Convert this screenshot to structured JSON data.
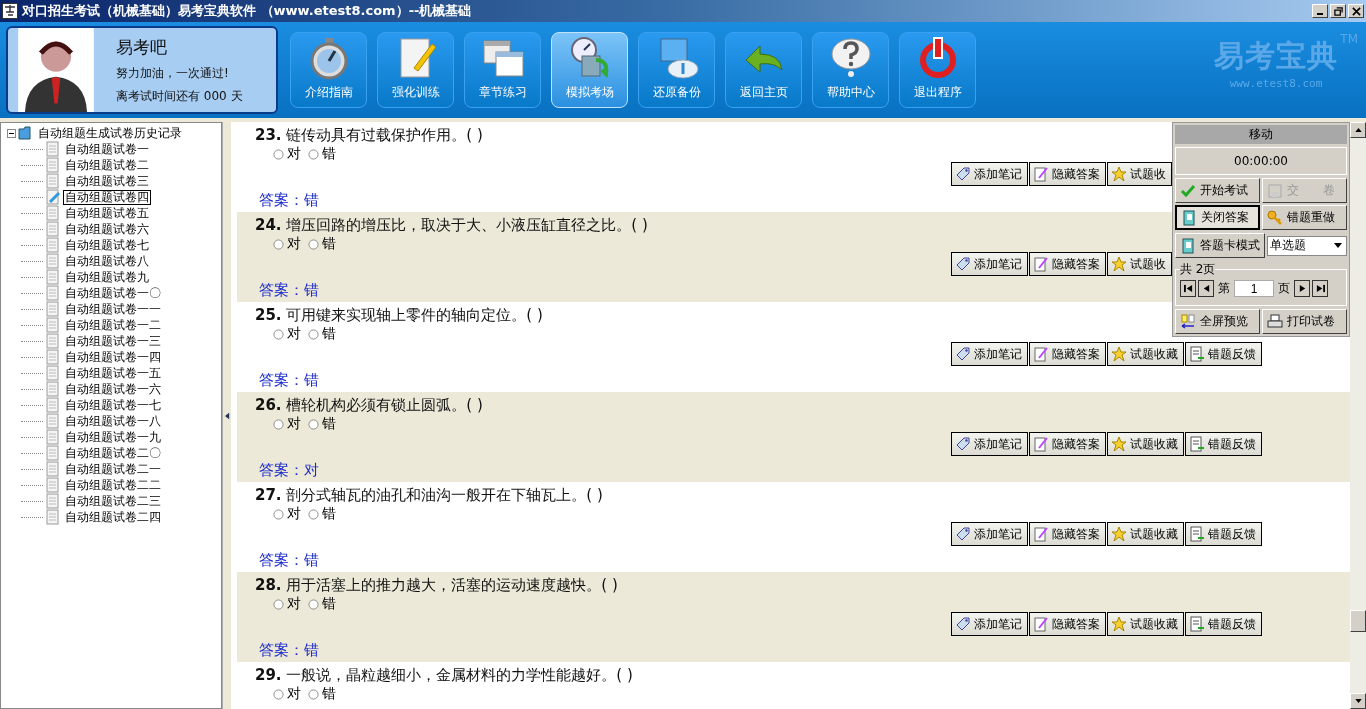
{
  "window": {
    "title": "对口招生考试（机械基础）易考宝典软件 （www.etest8.com）--机械基础"
  },
  "profile": {
    "name": "易考吧",
    "motto": "努力加油，一次通过!",
    "countdown": "离考试时间还有 000 天"
  },
  "toolbar": [
    {
      "kind": "stopwatch",
      "label": "介绍指南",
      "selected": false
    },
    {
      "kind": "notepad",
      "label": "强化训练",
      "selected": false
    },
    {
      "kind": "windows",
      "label": "章节练习",
      "selected": false
    },
    {
      "kind": "clock",
      "label": "模拟考场",
      "selected": true
    },
    {
      "kind": "backup",
      "label": "还原备份",
      "selected": false
    },
    {
      "kind": "back",
      "label": "返回主页",
      "selected": false
    },
    {
      "kind": "help",
      "label": "帮助中心",
      "selected": false
    },
    {
      "kind": "power",
      "label": "退出程序",
      "selected": false
    }
  ],
  "logo": {
    "name": "易考宝典",
    "trademark": "TM",
    "url": "www.etest8.com"
  },
  "tree": {
    "label": "自动组题生成试卷历史记录",
    "expanded": true,
    "children": [
      {
        "label": "自动组题试卷一",
        "selected": false
      },
      {
        "label": "自动组题试卷二",
        "selected": false
      },
      {
        "label": "自动组题试卷三",
        "selected": false
      },
      {
        "label": "自动组题试卷四",
        "selected": true
      },
      {
        "label": "自动组题试卷五",
        "selected": false
      },
      {
        "label": "自动组题试卷六",
        "selected": false
      },
      {
        "label": "自动组题试卷七",
        "selected": false
      },
      {
        "label": "自动组题试卷八",
        "selected": false
      },
      {
        "label": "自动组题试卷九",
        "selected": false
      },
      {
        "label": "自动组题试卷一〇",
        "selected": false
      },
      {
        "label": "自动组题试卷一一",
        "selected": false
      },
      {
        "label": "自动组题试卷一二",
        "selected": false
      },
      {
        "label": "自动组题试卷一三",
        "selected": false
      },
      {
        "label": "自动组题试卷一四",
        "selected": false
      },
      {
        "label": "自动组题试卷一五",
        "selected": false
      },
      {
        "label": "自动组题试卷一六",
        "selected": false
      },
      {
        "label": "自动组题试卷一七",
        "selected": false
      },
      {
        "label": "自动组题试卷一八",
        "selected": false
      },
      {
        "label": "自动组题试卷一九",
        "selected": false
      },
      {
        "label": "自动组题试卷二〇",
        "selected": false
      },
      {
        "label": "自动组题试卷二一",
        "selected": false
      },
      {
        "label": "自动组题试卷二二",
        "selected": false
      },
      {
        "label": "自动组题试卷二三",
        "selected": false
      },
      {
        "label": "自动组题试卷二四",
        "selected": false
      }
    ]
  },
  "questions": [
    {
      "number": "23.",
      "text": "链传动具有过载保护作用。( )",
      "options": [
        {
          "label": "对",
          "selected": false
        },
        {
          "label": "错",
          "selected": false
        }
      ],
      "actions": [
        {
          "kind": "note",
          "label": "添加笔记"
        },
        {
          "kind": "hide",
          "label": "隐藏答案"
        },
        {
          "kind": "star",
          "label": "试题收"
        }
      ],
      "answer": "答案：错"
    },
    {
      "number": "24.",
      "text": "增压回路的增压比，取决于大、小液压缸直径之比。( )",
      "options": [
        {
          "label": "对",
          "selected": false
        },
        {
          "label": "错",
          "selected": false
        }
      ],
      "actions": [
        {
          "kind": "note",
          "label": "添加笔记"
        },
        {
          "kind": "hide",
          "label": "隐藏答案"
        },
        {
          "kind": "star",
          "label": "试题收"
        }
      ],
      "answer": "答案：错"
    },
    {
      "number": "25.",
      "text": "可用键来实现轴上零件的轴向定位。( )",
      "options": [
        {
          "label": "对",
          "selected": false
        },
        {
          "label": "错",
          "selected": false
        }
      ],
      "actions": [
        {
          "kind": "note",
          "label": "添加笔记"
        },
        {
          "kind": "hide",
          "label": "隐藏答案"
        },
        {
          "kind": "star",
          "label": "试题收藏"
        },
        {
          "kind": "feedback",
          "label": "错题反馈"
        }
      ],
      "answer": "答案：错"
    },
    {
      "number": "26.",
      "text": "槽轮机构必须有锁止圆弧。( )",
      "options": [
        {
          "label": "对",
          "selected": false
        },
        {
          "label": "错",
          "selected": false
        }
      ],
      "actions": [
        {
          "kind": "note",
          "label": "添加笔记"
        },
        {
          "kind": "hide",
          "label": "隐藏答案"
        },
        {
          "kind": "star",
          "label": "试题收藏"
        },
        {
          "kind": "feedback",
          "label": "错题反馈"
        }
      ],
      "answer": "答案：对"
    },
    {
      "number": "27.",
      "text": "剖分式轴瓦的油孔和油沟一般开在下轴瓦上。( )",
      "options": [
        {
          "label": "对",
          "selected": false
        },
        {
          "label": "错",
          "selected": false
        }
      ],
      "actions": [
        {
          "kind": "note",
          "label": "添加笔记"
        },
        {
          "kind": "hide",
          "label": "隐藏答案"
        },
        {
          "kind": "star",
          "label": "试题收藏"
        },
        {
          "kind": "feedback",
          "label": "错题反馈"
        }
      ],
      "answer": "答案：错"
    },
    {
      "number": "28.",
      "text": "用于活塞上的推力越大，活塞的运动速度越快。( )",
      "options": [
        {
          "label": "对",
          "selected": false
        },
        {
          "label": "错",
          "selected": false
        }
      ],
      "actions": [
        {
          "kind": "note",
          "label": "添加笔记"
        },
        {
          "kind": "hide",
          "label": "隐藏答案"
        },
        {
          "kind": "star",
          "label": "试题收藏"
        },
        {
          "kind": "feedback",
          "label": "错题反馈"
        }
      ],
      "answer": "答案：错"
    },
    {
      "number": "29.",
      "text": "一般说，晶粒越细小，金属材料的力学性能越好。( )",
      "options": [
        {
          "label": "对",
          "selected": false
        },
        {
          "label": "错",
          "selected": false
        }
      ]
    }
  ],
  "panel": {
    "title": "移动",
    "timer": "00:00:00",
    "buttons": [
      {
        "kind": "check",
        "label": "开始考试",
        "disabled": false,
        "selected": false
      },
      {
        "kind": "save",
        "label": "交　　卷",
        "disabled": true,
        "selected": false
      },
      {
        "kind": "book",
        "label": "关闭答案",
        "disabled": false,
        "selected": true
      },
      {
        "kind": "key",
        "label": "错题重做",
        "disabled": false,
        "selected": false
      }
    ],
    "card_button": "答题卡模式",
    "type_select": "单选题",
    "pages": "共 2页",
    "page_prefix": "第",
    "page": "1",
    "page_suffix": "页",
    "bottom_buttons": [
      {
        "kind": "preview",
        "label": "全屏预览"
      },
      {
        "kind": "print",
        "label": "打印试卷"
      }
    ]
  }
}
